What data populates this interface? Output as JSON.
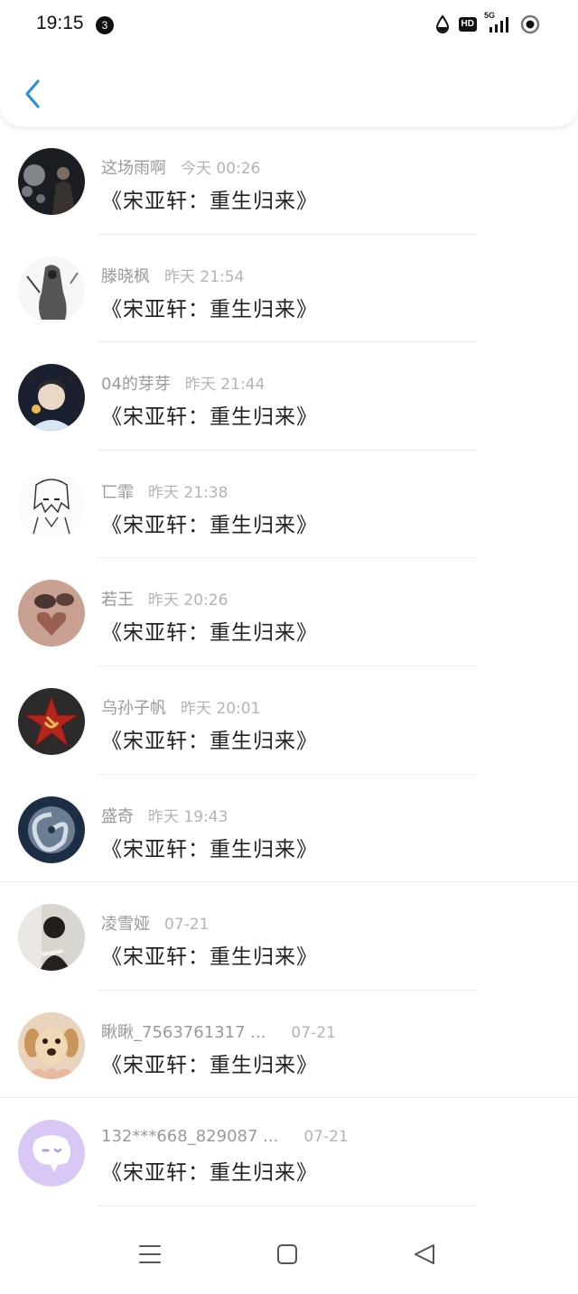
{
  "status_bar": {
    "time": "19:15",
    "notification_count": "3",
    "hd_label": "HD",
    "network_label": "5G"
  },
  "header": {
    "back_icon": "chevron-left-icon",
    "accent_color": "#2b8fe0"
  },
  "items": [
    {
      "name": "这场雨啊",
      "time": "今天 00:26",
      "title": "《宋亚轩：重生归来》"
    },
    {
      "name": "滕晓枫",
      "time": "昨天 21:54",
      "title": "《宋亚轩：重生归来》"
    },
    {
      "name": "04的芽芽",
      "time": "昨天 21:44",
      "title": "《宋亚轩：重生归来》"
    },
    {
      "name": "匸霏",
      "time": "昨天 21:38",
      "title": "《宋亚轩：重生归来》"
    },
    {
      "name": "若王",
      "time": "昨天 20:26",
      "title": "《宋亚轩：重生归来》"
    },
    {
      "name": "乌孙子帆",
      "time": "昨天 20:01",
      "title": "《宋亚轩：重生归来》"
    },
    {
      "name": "盛奇",
      "time": "昨天 19:43",
      "title": "《宋亚轩：重生归来》"
    },
    {
      "name": "凌雪娅",
      "time": "07-21",
      "title": "《宋亚轩：重生归来》"
    },
    {
      "name": "瞅瞅_7563761317 ...",
      "time": "07-21",
      "title": "《宋亚轩：重生归来》"
    },
    {
      "name": "132***668_829087 ...",
      "time": "07-21",
      "title": "《宋亚轩：重生归来》"
    }
  ],
  "nav": {
    "menu_icon": "menu-icon",
    "home_icon": "home-square-icon",
    "back_icon": "back-triangle-icon"
  }
}
